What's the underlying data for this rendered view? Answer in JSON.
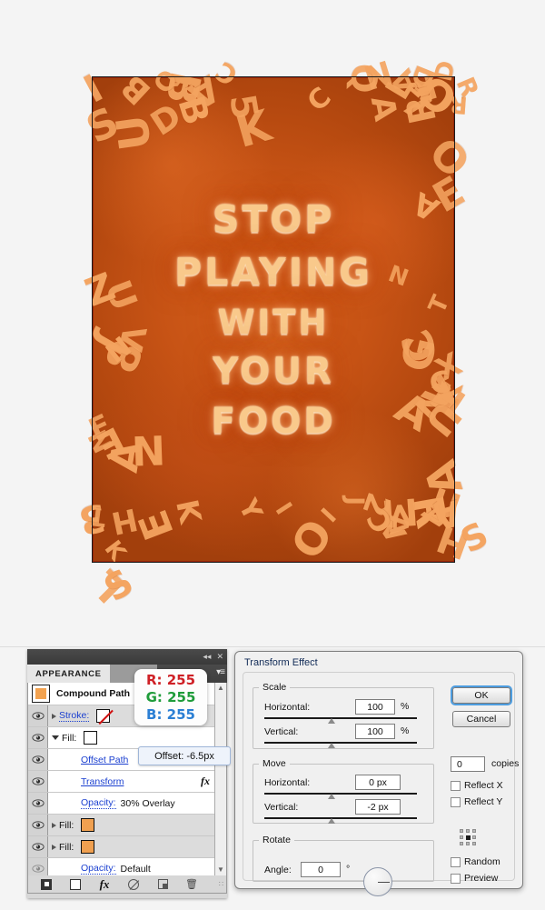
{
  "artwork": {
    "headline_lines": [
      "STOP",
      "PLAYING",
      "WITH",
      "YOUR",
      "FOOD"
    ],
    "border_letters": [
      "R",
      "A",
      "H",
      "U",
      "B",
      "E",
      "I",
      "N",
      "D",
      "O",
      "U",
      "F",
      "N",
      "L",
      "O",
      "3",
      "Q",
      "A",
      "T",
      "8",
      "C",
      "T",
      "Y",
      "E",
      "5",
      "X",
      "R",
      "Z",
      "B",
      "2",
      "H",
      "A",
      "7",
      "K",
      "V",
      "I",
      "C",
      "N",
      "J",
      "L",
      "A",
      "H",
      "M",
      "S",
      "R",
      "C",
      "A",
      "V",
      "R",
      "A",
      "E",
      "N",
      "Q",
      "C",
      "I",
      "K",
      "F",
      "G",
      "K",
      "J",
      "D",
      "O",
      "2",
      "B",
      "A",
      "F",
      "S",
      "S",
      "A",
      "V",
      "A",
      "N",
      "K",
      "U",
      "C",
      "U",
      "D",
      "A"
    ],
    "colors": {
      "pasta": "#f4a460",
      "sauce_dark": "#a23f0c",
      "sauce_light": "#d8621d"
    }
  },
  "appearance_panel": {
    "tab_label": "APPEARANCE",
    "collapse_icon": "◂◂",
    "close_icon": "✕",
    "menu_icon": "▾≡",
    "object_title": "Compound Path",
    "rows": [
      {
        "name": "stroke",
        "label": "Stroke:",
        "kind": "link-dotted",
        "swatch": "none",
        "disclosure": "right",
        "indent": false,
        "alt": true
      },
      {
        "name": "fill",
        "label": "Fill:",
        "kind": "plain",
        "swatch": "white",
        "disclosure": "down",
        "indent": false,
        "alt": false
      },
      {
        "name": "offset-path",
        "label": "Offset Path",
        "kind": "link",
        "swatch": "",
        "disclosure": "none",
        "indent": true,
        "alt": false
      },
      {
        "name": "transform",
        "label": "Transform",
        "kind": "link",
        "swatch": "",
        "disclosure": "none",
        "indent": true,
        "alt": false,
        "fx": "fx"
      },
      {
        "name": "opacity-1",
        "label": "Opacity:",
        "kind": "link-dotted",
        "value": "30% Overlay",
        "disclosure": "none",
        "indent": true,
        "alt": false
      },
      {
        "name": "fill-2",
        "label": "Fill:",
        "kind": "plain",
        "swatch": "orange",
        "disclosure": "right",
        "indent": false,
        "alt": true
      },
      {
        "name": "fill-3",
        "label": "Fill:",
        "kind": "plain",
        "swatch": "orange",
        "disclosure": "right",
        "indent": false,
        "alt": true
      },
      {
        "name": "opacity-2",
        "label": "Opacity:",
        "kind": "link-dotted",
        "value": "Default",
        "disclosure": "none",
        "indent": true,
        "alt": false
      }
    ],
    "footer_buttons": [
      {
        "name": "add-new-stroke-button",
        "icon": "stroke-square-icon"
      },
      {
        "name": "add-new-fill-button",
        "icon": "fill-square-icon"
      },
      {
        "name": "add-new-effect-button",
        "icon": "fx-icon"
      },
      {
        "name": "clear-appearance-button",
        "icon": "no-symbol-icon"
      },
      {
        "name": "duplicate-item-button",
        "icon": "duplicate-icon"
      },
      {
        "name": "delete-item-button",
        "icon": "trash-icon"
      }
    ],
    "scroll_up_icon": "▲",
    "scroll_down_icon": "▼",
    "grip_icon": "∷"
  },
  "tooltips": {
    "rgb": {
      "r": "R: 255",
      "g": "G: 255",
      "b": "B: 255",
      "r_color": "#cf2026",
      "g_color": "#1f9c3a",
      "b_color": "#2b7fd4"
    },
    "offset": "Offset: -6.5px"
  },
  "dialog": {
    "title": "Transform Effect",
    "scale": {
      "legend": "Scale",
      "horizontal_label": "Horizontal:",
      "horizontal_value": "100",
      "horizontal_unit": "%",
      "vertical_label": "Vertical:",
      "vertical_value": "100",
      "vertical_unit": "%"
    },
    "move": {
      "legend": "Move",
      "horizontal_label": "Horizontal:",
      "horizontal_value": "0 px",
      "vertical_label": "Vertical:",
      "vertical_value": "-2 px"
    },
    "rotate": {
      "legend": "Rotate",
      "angle_label": "Angle:",
      "angle_value": "0",
      "angle_unit": "°"
    },
    "ok_label": "OK",
    "cancel_label": "Cancel",
    "copies_value": "0",
    "copies_label": "copies",
    "reflect_x_label": "Reflect X",
    "reflect_y_label": "Reflect Y",
    "random_label": "Random",
    "preview_label": "Preview",
    "checkboxes_checked": false
  }
}
